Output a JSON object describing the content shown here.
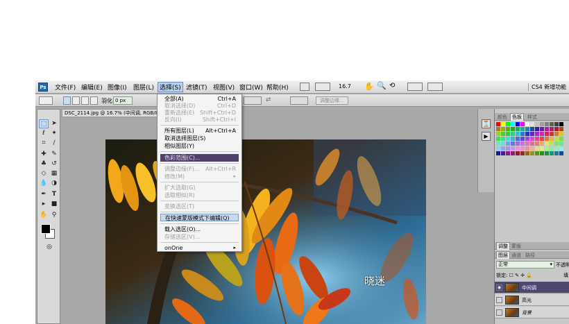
{
  "app": {
    "logo": "Ps",
    "menus": [
      "文件(F)",
      "编辑(E)",
      "图像(I)",
      "图层(L)",
      "选择(S)",
      "滤镜(T)",
      "视图(V)",
      "窗口(W)",
      "帮助(H)"
    ],
    "zoom_display": "16.7",
    "workspace": "CS4 新增功能"
  },
  "options_bar": {
    "feather_label": "羽化:",
    "feather_value": "0 px",
    "refine_edge": "调整边缘..."
  },
  "document": {
    "tab_title": "DSC_2114.jpg @ 16.7% (中间调, RGB/8)",
    "watermark": "晓迷"
  },
  "select_menu": {
    "items": [
      {
        "label": "全部(A)",
        "shortcut": "Ctrl+A",
        "state": "enabled"
      },
      {
        "label": "取消选择(D)",
        "shortcut": "Ctrl+D",
        "state": "disabled"
      },
      {
        "label": "重新选择(E)",
        "shortcut": "Shift+Ctrl+D",
        "state": "disabled"
      },
      {
        "label": "反向(I)",
        "shortcut": "Shift+Ctrl+I",
        "state": "disabled"
      },
      {
        "label": "所有图层(L)",
        "shortcut": "Alt+Ctrl+A",
        "state": "enabled"
      },
      {
        "label": "取消选择图层(S)",
        "shortcut": "",
        "state": "enabled"
      },
      {
        "label": "相似图层(Y)",
        "shortcut": "",
        "state": "enabled"
      },
      {
        "label": "色彩范围(C)...",
        "shortcut": "",
        "state": "highlighted"
      },
      {
        "label": "调整边缘(F)...",
        "shortcut": "Alt+Ctrl+R",
        "state": "disabled"
      },
      {
        "label": "修改(M)",
        "shortcut": "",
        "state": "disabled",
        "submenu": true
      },
      {
        "label": "扩大选取(G)",
        "shortcut": "",
        "state": "disabled"
      },
      {
        "label": "选取相似(R)",
        "shortcut": "",
        "state": "disabled"
      },
      {
        "label": "变换选区(T)",
        "shortcut": "",
        "state": "disabled"
      },
      {
        "label": "在快速蒙版模式下编辑(Q)",
        "shortcut": "",
        "state": "quickmask"
      },
      {
        "label": "载入选区(O)...",
        "shortcut": "",
        "state": "enabled"
      },
      {
        "label": "存储选区(V)...",
        "shortcut": "",
        "state": "disabled"
      },
      {
        "label": "onOne",
        "shortcut": "",
        "state": "enabled",
        "submenu": true
      }
    ]
  },
  "panels": {
    "swatch_tabs": [
      "颜色",
      "色板",
      "样式"
    ],
    "adjust_tabs": [
      "调整",
      "蒙版"
    ],
    "layer_tabs": [
      "图层",
      "通道",
      "路径"
    ],
    "blend_mode": "正常",
    "opacity_label": "不透明",
    "lock_label": "锁定:",
    "fill_label": "填",
    "layers": [
      {
        "name": "中间调",
        "selected": true
      },
      {
        "name": "高光",
        "selected": false
      },
      {
        "name": "背景",
        "selected": false
      }
    ]
  },
  "colors": {
    "highlight": "#4f3f6b",
    "layer_selected": "#4d4870"
  }
}
